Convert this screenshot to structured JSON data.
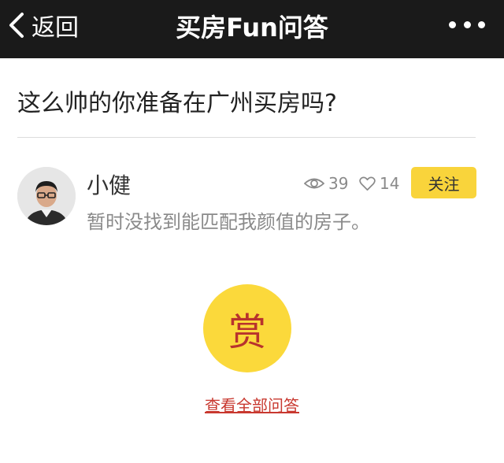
{
  "navbar": {
    "back_label": "返回",
    "title": "买房Fun问答",
    "back_icon": "chevron-left-icon",
    "more_icon": "more-dots-icon",
    "background": "#1a1a1a"
  },
  "question": {
    "text": "这么帅的你准备在广州买房吗?"
  },
  "answer": {
    "author": "小健",
    "views": "39",
    "likes": "14",
    "follow_label": "关注",
    "text": "暂时没找到能匹配我颜值的房子。",
    "avatar_icon": "user-avatar",
    "views_icon": "eye-icon",
    "likes_icon": "heart-outline-icon"
  },
  "reward": {
    "label": "赏",
    "color": "#fbd93b"
  },
  "footer": {
    "view_all_label": "查看全部问答",
    "link_color": "#c8382f"
  },
  "colors": {
    "accent_yellow": "#f9d43b",
    "muted_text": "#8a8a8a"
  }
}
